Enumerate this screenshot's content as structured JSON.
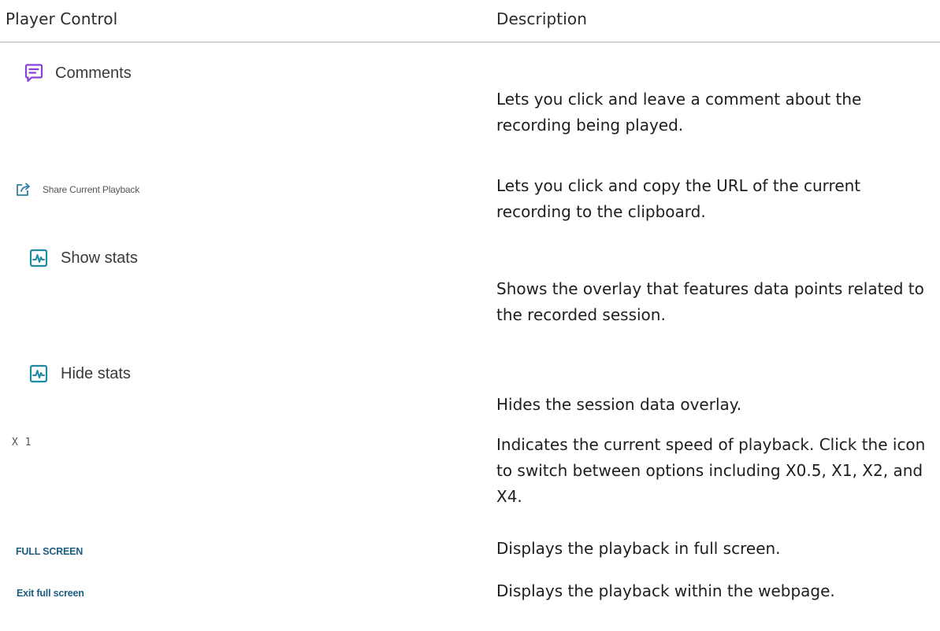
{
  "header": {
    "col_control": "Player Control",
    "col_description": "Description"
  },
  "colors": {
    "comments_icon": "#8b3fd9",
    "stats_icon": "#1f8aa3",
    "full_screen_text": "#1d5d80"
  },
  "rows": [
    {
      "control_label": "Comments",
      "icon": "comment-icon",
      "description": "Lets you click and leave a comment about the recording being played."
    },
    {
      "control_label": "Share Current Playback",
      "icon": "share-icon",
      "description": "Lets you click and copy the URL of the current recording to the clipboard."
    },
    {
      "control_label": "Show stats",
      "icon": "stats-icon",
      "description": "Shows the overlay that features data points related to the recorded session."
    },
    {
      "control_label": "Hide stats",
      "icon": "stats-icon",
      "description": "Hides the session data overlay."
    },
    {
      "control_label": "X 1",
      "description": "Indicates the current speed of playback. Click the icon to switch between options including X0.5, X1, X2, and X4."
    },
    {
      "control_label": "FULL SCREEN",
      "description": "Displays the playback in full screen."
    },
    {
      "control_label": "Exit full screen",
      "description": "Displays the playback within the webpage."
    }
  ]
}
